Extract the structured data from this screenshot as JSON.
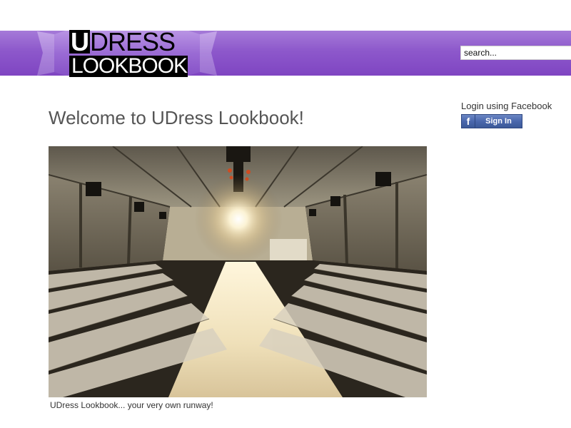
{
  "header": {
    "logo": {
      "line1_initial": "U",
      "line1_rest": "DRESS",
      "line2": "LOOKBOOK"
    },
    "search": {
      "placeholder": "search..."
    },
    "colors": {
      "band": "#8d58cb",
      "band_light": "#a57ad8"
    }
  },
  "main": {
    "title": "Welcome to UDress Lookbook!",
    "caption": "UDress Lookbook... your very own runway!"
  },
  "sidebar": {
    "login_label": "Login using Facebook",
    "facebook_button": {
      "icon": "f",
      "label": "Sign In",
      "color": "#3b5998"
    }
  }
}
